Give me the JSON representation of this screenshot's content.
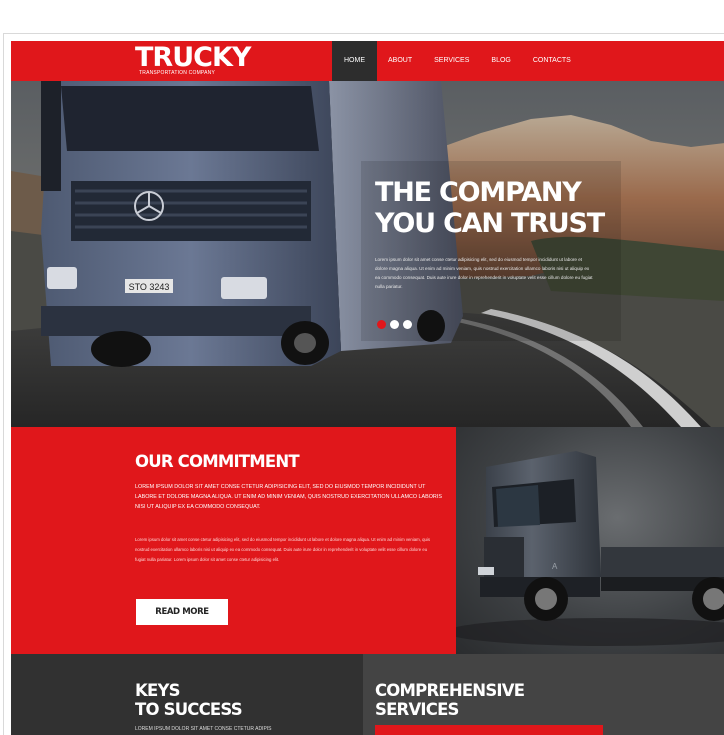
{
  "colors": {
    "accent": "#e0171b",
    "dark": "#313131",
    "nav_active": "#2d2d2d",
    "white": "#ffffff"
  },
  "header": {
    "logo_word": "TRUCKY",
    "logo_tagline": "TRANSPORTATION COMPANY",
    "nav": [
      "HOME",
      "ABOUT",
      "SERVICES",
      "BLOG",
      "CONTACTS"
    ],
    "active_nav": "HOME"
  },
  "hero": {
    "title_line1": "THE COMPANY",
    "title_line2": "YOU CAN TRUST",
    "body": "Lorem ipsum dolor sit amet conse ctetur adipisicing elit, sed do eiusmod tempor incididunt ut labore et dolore magna aliqua. Ut enim ad minim veniam, quis nostrud exercitation ullamco laboris nisi ut aliquip ex ea commodo consequat. Duis aute irure dolor in reprehenderit in voluptate velit esse cillum dolore eu fugiat nulla pariatur.",
    "plate": "STO 3243",
    "slider": {
      "count": 3,
      "active_index": 0
    }
  },
  "commitment": {
    "title": "OUR COMMITMENT",
    "lead": "LOREM IPSUM DOLOR SIT AMET CONSE CTETUR ADIPISICING ELIT, SED DO EIUSMOD TEMPOR INCIDIDUNT UT LABORE ET DOLORE MAGNA ALIQUA. UT ENIM AD MINIM VENIAM, QUIS NOSTRUD EXERCITATION ULLAMCO LABORIS NISI UT ALIQUIP EX EA COMMODO CONSEQUAT.",
    "body": "Lorem ipsum dolor sit amet conse ctetur adipisicing elit, sed do eiusmod tempor incididunt ut labore et dolore magna aliqua. Ut enim ad minim veniam, quis nostrud exercitation ullamco laboris nisi ut aliquip ex ea commodo consequat. Duis aute irure dolor in reprehenderit in voluptate velit esse cillum dolore eu fugiat nulla pariatur. Lorem ipsum dolor sit amet conse ctetur adipisicing elit.",
    "button": "READ MORE"
  },
  "keys": {
    "title_line1": "KEYS",
    "title_line2": "TO SUCCESS",
    "text": "LOREM IPSUM DOLOR SIT AMET CONSE CTETUR ADIPIS"
  },
  "services": {
    "title_line1": "COMPREHENSIVE",
    "title_line2": "SERVICES"
  }
}
